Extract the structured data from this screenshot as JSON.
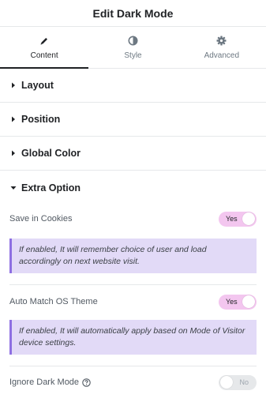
{
  "header": {
    "title": "Edit Dark Mode"
  },
  "tabs": [
    {
      "label": "Content",
      "icon": "pencil-icon",
      "active": true
    },
    {
      "label": "Style",
      "icon": "half-circle-icon",
      "active": false
    },
    {
      "label": "Advanced",
      "icon": "gear-icon",
      "active": false
    }
  ],
  "sections": [
    {
      "title": "Layout",
      "open": false
    },
    {
      "title": "Position",
      "open": false
    },
    {
      "title": "Global Color",
      "open": false
    },
    {
      "title": "Extra Option",
      "open": true
    }
  ],
  "controls": {
    "save_cookies": {
      "label": "Save in Cookies",
      "toggle": "Yes",
      "notice": "If enabled, It will remember choice of user and load accordingly on next website visit."
    },
    "auto_match": {
      "label": "Auto Match OS Theme",
      "toggle": "Yes",
      "notice": "If enabled, It will automatically apply based on Mode of Visitor device settings."
    },
    "ignore_dark": {
      "label": "Ignore Dark Mode",
      "toggle": "No"
    }
  },
  "colors": {
    "toggle_on": "#f3c6ef",
    "toggle_off": "#e6e8ea",
    "notice_bg": "#e2daf7",
    "notice_border": "#8e6fe2"
  }
}
